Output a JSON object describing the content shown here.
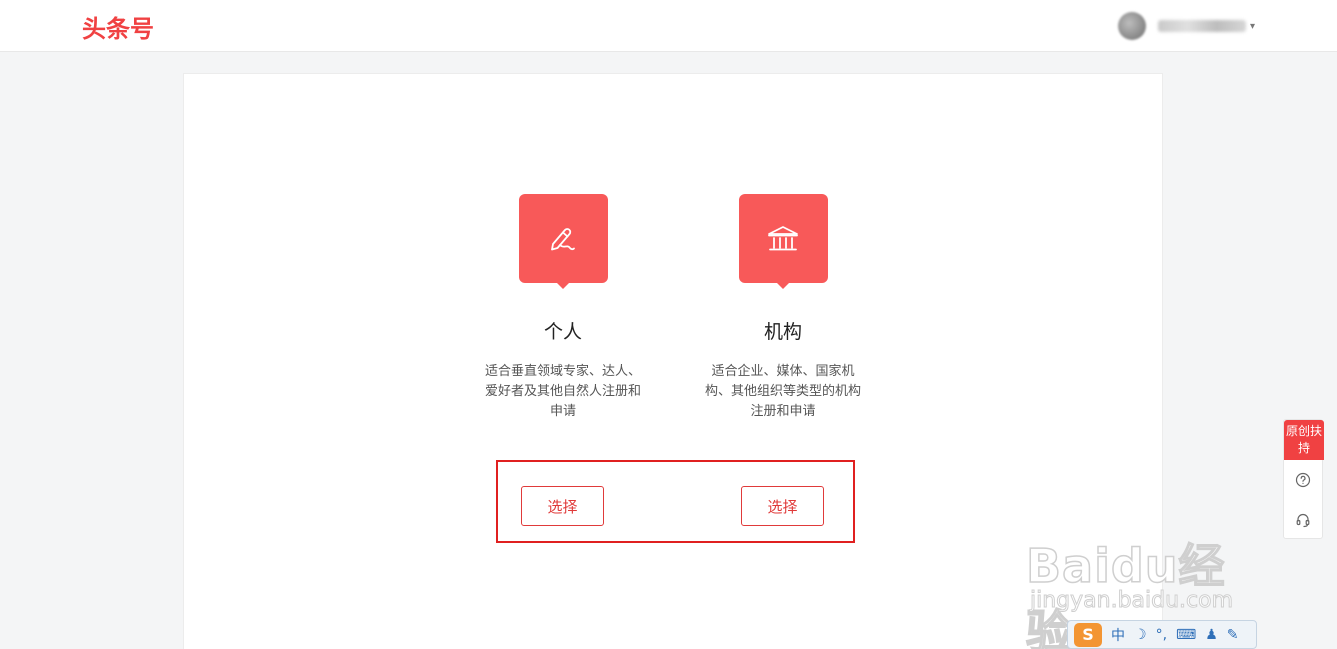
{
  "header": {
    "logo": "头条号",
    "user_menu_caret": "▾"
  },
  "options": [
    {
      "icon": "pen-icon",
      "title": "个人",
      "description": "适合垂直领域专家、达人、爱好者及其他自然人注册和申请",
      "button_label": "选择"
    },
    {
      "icon": "institution-icon",
      "title": "机构",
      "description": "适合企业、媒体、国家机构、其他组织等类型的机构注册和申请",
      "button_label": "选择"
    }
  ],
  "side_toolbar": {
    "promo_label": "原创扶持",
    "help_icon": "question-icon",
    "service_icon": "headset-icon"
  },
  "watermark": {
    "main": "Baidu经验",
    "sub": "jingyan.baidu.com"
  },
  "ime_bar": {
    "logo": "S",
    "mode": "中",
    "items": [
      "☽",
      "°,",
      "⌨",
      "♟",
      "✎"
    ]
  },
  "colors": {
    "brand": "#f04142",
    "accent": "#f85959",
    "highlight_border": "#e02020"
  }
}
